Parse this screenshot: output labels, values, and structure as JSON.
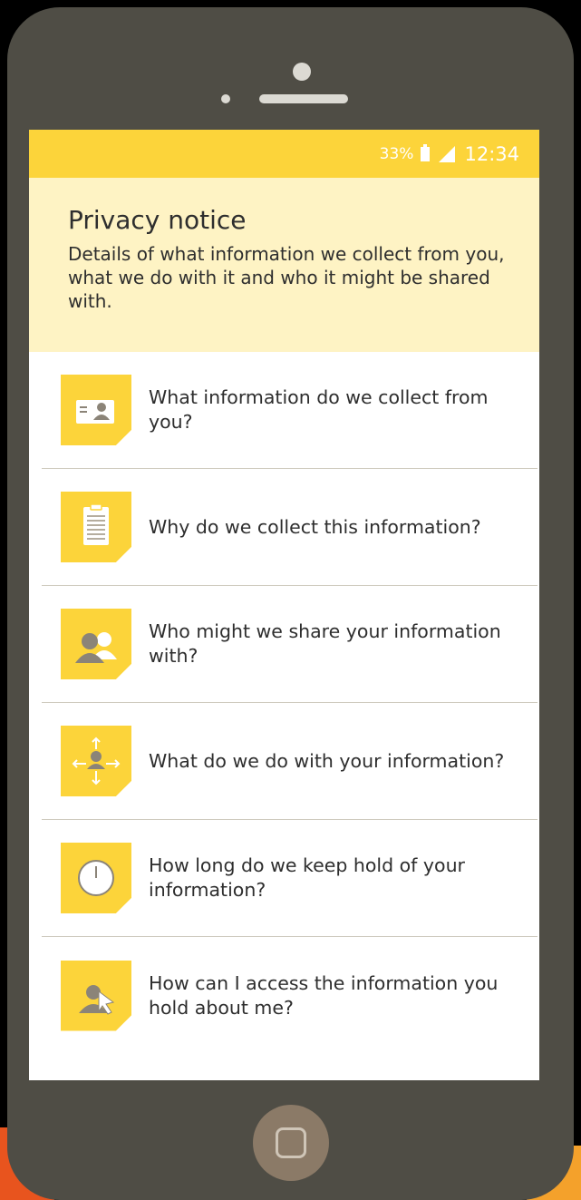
{
  "status_bar": {
    "battery_percent": "33%",
    "time": "12:34"
  },
  "header": {
    "title": "Privacy notice",
    "description": "Details of what information we collect from you, what we do with it and who it might be shared with."
  },
  "items": [
    {
      "label": "What information do we collect from you?",
      "icon": "id-card-icon"
    },
    {
      "label": "Why do we collect this information?",
      "icon": "clipboard-icon"
    },
    {
      "label": "Who might we share your information with?",
      "icon": "people-icon"
    },
    {
      "label": "What do we do with your information?",
      "icon": "person-arrows-icon"
    },
    {
      "label": "How long do we keep hold of your information?",
      "icon": "clock-icon"
    },
    {
      "label": "How can I access the information you hold about me?",
      "icon": "person-cursor-icon"
    }
  ],
  "colors": {
    "accent_yellow": "#fcd43a",
    "header_background": "#fef3c4",
    "phone_body": "#4f4d45"
  }
}
